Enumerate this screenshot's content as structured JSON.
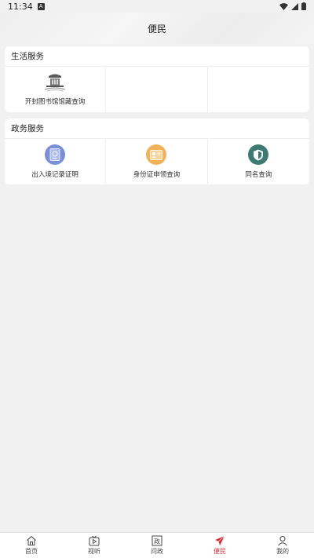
{
  "status_bar": {
    "time": "11:34",
    "notification_badge": "A"
  },
  "header": {
    "title": "便民"
  },
  "sections": [
    {
      "title": "生活服务",
      "items": [
        {
          "label": "开封图书馆馆藏查询",
          "icon": "library-building-icon"
        }
      ]
    },
    {
      "title": "政务服务",
      "items": [
        {
          "label": "出入境记录证明",
          "icon": "passport-icon",
          "color": "#7b8fd6"
        },
        {
          "label": "身份证申领查询",
          "icon": "id-card-icon",
          "color": "#f0b25a"
        },
        {
          "label": "同名查询",
          "icon": "shield-search-icon",
          "color": "#3e7a72"
        }
      ]
    }
  ],
  "tab_bar": {
    "tabs": [
      {
        "label": "首页",
        "icon": "home-icon"
      },
      {
        "label": "视听",
        "icon": "tv-play-icon"
      },
      {
        "label": "问政",
        "icon": "politics-icon",
        "icon_glyph": "政"
      },
      {
        "label": "便民",
        "icon": "paper-plane-icon",
        "active": true
      },
      {
        "label": "我的",
        "icon": "user-icon"
      }
    ],
    "active_color": "#d9232d"
  }
}
